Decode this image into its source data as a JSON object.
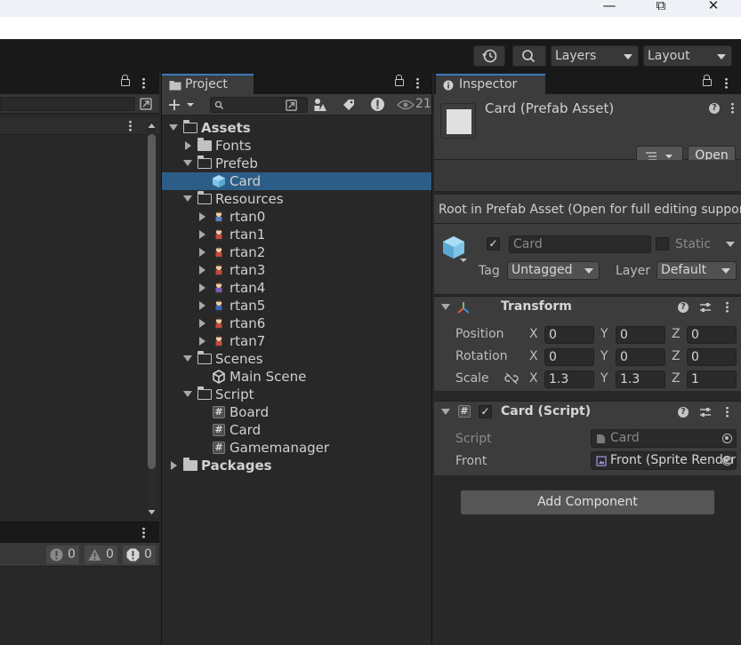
{
  "toolbar": {
    "layers_label": "Layers",
    "layout_label": "Layout"
  },
  "console": {
    "info_count": "0",
    "warn_count": "0",
    "error_count": "0"
  },
  "project": {
    "tab_label": "Project",
    "visible_count": "21",
    "tree": [
      {
        "label": "Assets",
        "depth": 0,
        "state": "open",
        "kind": "folder-open",
        "bold": true
      },
      {
        "label": "Fonts",
        "depth": 1,
        "state": "closed",
        "kind": "folder"
      },
      {
        "label": "Prefeb",
        "depth": 1,
        "state": "open",
        "kind": "folder-open"
      },
      {
        "label": "Card",
        "depth": 2,
        "state": "none",
        "kind": "prefab",
        "selected": true
      },
      {
        "label": "Resources",
        "depth": 1,
        "state": "open",
        "kind": "folder-open"
      },
      {
        "label": "rtan0",
        "depth": 2,
        "state": "closed",
        "kind": "sprite"
      },
      {
        "label": "rtan1",
        "depth": 2,
        "state": "closed",
        "kind": "sprite"
      },
      {
        "label": "rtan2",
        "depth": 2,
        "state": "closed",
        "kind": "sprite"
      },
      {
        "label": "rtan3",
        "depth": 2,
        "state": "closed",
        "kind": "sprite"
      },
      {
        "label": "rtan4",
        "depth": 2,
        "state": "closed",
        "kind": "sprite"
      },
      {
        "label": "rtan5",
        "depth": 2,
        "state": "closed",
        "kind": "sprite"
      },
      {
        "label": "rtan6",
        "depth": 2,
        "state": "closed",
        "kind": "sprite"
      },
      {
        "label": "rtan7",
        "depth": 2,
        "state": "closed",
        "kind": "sprite"
      },
      {
        "label": "Scenes",
        "depth": 1,
        "state": "open",
        "kind": "folder-open"
      },
      {
        "label": "Main Scene",
        "depth": 2,
        "state": "none",
        "kind": "scene"
      },
      {
        "label": "Script",
        "depth": 1,
        "state": "open",
        "kind": "folder-open"
      },
      {
        "label": "Board",
        "depth": 2,
        "state": "none",
        "kind": "script"
      },
      {
        "label": "Card",
        "depth": 2,
        "state": "none",
        "kind": "script"
      },
      {
        "label": "Gamemanager",
        "depth": 2,
        "state": "none",
        "kind": "script"
      },
      {
        "label": "Packages",
        "depth": 0,
        "state": "closed",
        "kind": "folder",
        "bold": true
      }
    ]
  },
  "inspector": {
    "tab_label": "Inspector",
    "title": "Card (Prefab Asset)",
    "open_label": "Open",
    "root_message": "Root in Prefab Asset (Open for full editing support)",
    "object_name": "Card",
    "static_label": "Static",
    "tag_label": "Tag",
    "tag_value": "Untagged",
    "layer_label": "Layer",
    "layer_value": "Default",
    "transform": {
      "title": "Transform",
      "position_label": "Position",
      "rotation_label": "Rotation",
      "scale_label": "Scale",
      "axis_x": "X",
      "axis_y": "Y",
      "axis_z": "Z",
      "position": {
        "x": "0",
        "y": "0",
        "z": "0"
      },
      "rotation": {
        "x": "0",
        "y": "0",
        "z": "0"
      },
      "scale": {
        "x": "1.3",
        "y": "1.3",
        "z": "1"
      }
    },
    "card_script": {
      "title": "Card (Script)",
      "script_label": "Script",
      "script_value": "Card",
      "front_label": "Front",
      "front_value": "Front (Sprite Renderer)"
    },
    "add_component_label": "Add Component"
  },
  "colors": {
    "selection": "#2c5d87",
    "tab_accent": "#3a79bb"
  }
}
